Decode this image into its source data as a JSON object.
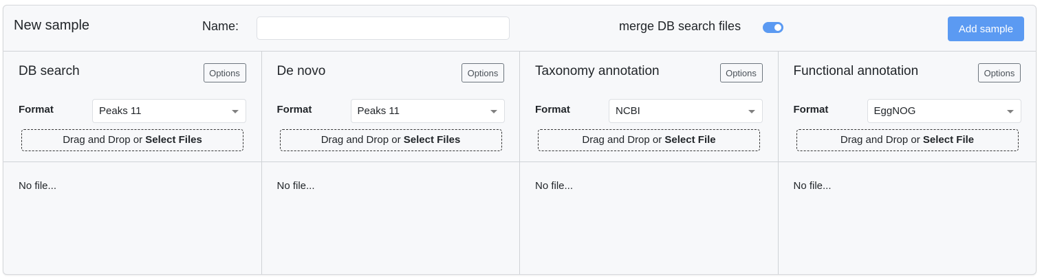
{
  "header": {
    "title": "New sample",
    "name_label": "Name:",
    "name_value": "",
    "merge_label": "merge DB search files",
    "merge_enabled": true,
    "add_button": "Add sample"
  },
  "columns": [
    {
      "title": "DB search",
      "options_label": "Options",
      "format_label": "Format",
      "format_value": "Peaks 11",
      "drop_text": "Drag and Drop or ",
      "drop_link": "Select Files",
      "status": "No file..."
    },
    {
      "title": "De novo",
      "options_label": "Options",
      "format_label": "Format",
      "format_value": "Peaks 11",
      "drop_text": "Drag and Drop or ",
      "drop_link": "Select Files",
      "status": "No file..."
    },
    {
      "title": "Taxonomy annotation",
      "options_label": "Options",
      "format_label": "Format",
      "format_value": "NCBI",
      "drop_text": "Drag and Drop or ",
      "drop_link": "Select File",
      "status": "No file..."
    },
    {
      "title": "Functional annotation",
      "options_label": "Options",
      "format_label": "Format",
      "format_value": "EggNOG",
      "drop_text": "Drag and Drop or ",
      "drop_link": "Select File",
      "status": "No file..."
    }
  ],
  "colors": {
    "accent": "#5b9af2",
    "panel_bg": "#f7f8fa"
  }
}
